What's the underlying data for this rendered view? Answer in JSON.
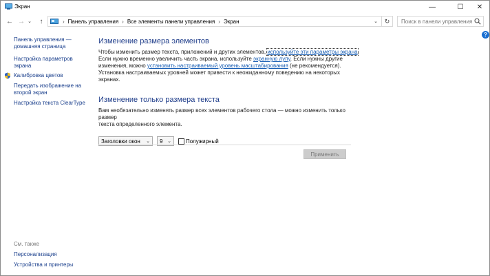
{
  "window": {
    "title": "Экран",
    "minimize": "—",
    "maximize": "☐",
    "close": "✕"
  },
  "nav": {
    "back": "←",
    "forward": "→",
    "recent": "⌄",
    "up": "↑",
    "breadcrumbs": [
      "Панель управления",
      "Все элементы панели управления",
      "Экран"
    ],
    "separator": "›",
    "dropdown": "⌄",
    "refresh": "↻",
    "search_placeholder": "Поиск в панели управления"
  },
  "sidebar": {
    "home_line1": "Панель управления —",
    "home_line2": "домашняя страница",
    "items": [
      {
        "line1": "Настройка параметров",
        "line2": "экрана"
      },
      {
        "line1": "Калибровка цветов"
      },
      {
        "line1": "Передать изображение на",
        "line2": "второй экран"
      },
      {
        "line1": "Настройка текста ClearType"
      }
    ],
    "see_also_title": "См. также",
    "see_also": [
      "Персонализация",
      "Устройства и принтеры"
    ]
  },
  "main": {
    "section1_title": "Изменение размера элементов",
    "p1_a": "Чтобы изменить размер текста, приложений и других элементов, ",
    "p1_link": "используйте эти параметры экрана",
    "p1_b": ".",
    "p2_a": "Если нужно временно увеличить часть экрана, используйте ",
    "p2_link": "экранную лупу",
    "p2_b": ". Если нужны другие",
    "p3_a": "изменения, можно ",
    "p3_link": "установить настраиваемый уровень масштабирования",
    "p3_b": " (не рекомендуется).",
    "p4": "Установка настраиваемых уровней может привести к неожиданному поведению на некоторых экранах.",
    "section2_title": "Изменение только размера текста",
    "p5": "Вам необязательно изменять размер всех элементов рабочего стола — можно изменить только размер",
    "p6": "текста определенного элемента.",
    "element_select": "Заголовки окон",
    "size_select": "9",
    "bold_label": "Полужирный",
    "apply_button": "Применить"
  }
}
